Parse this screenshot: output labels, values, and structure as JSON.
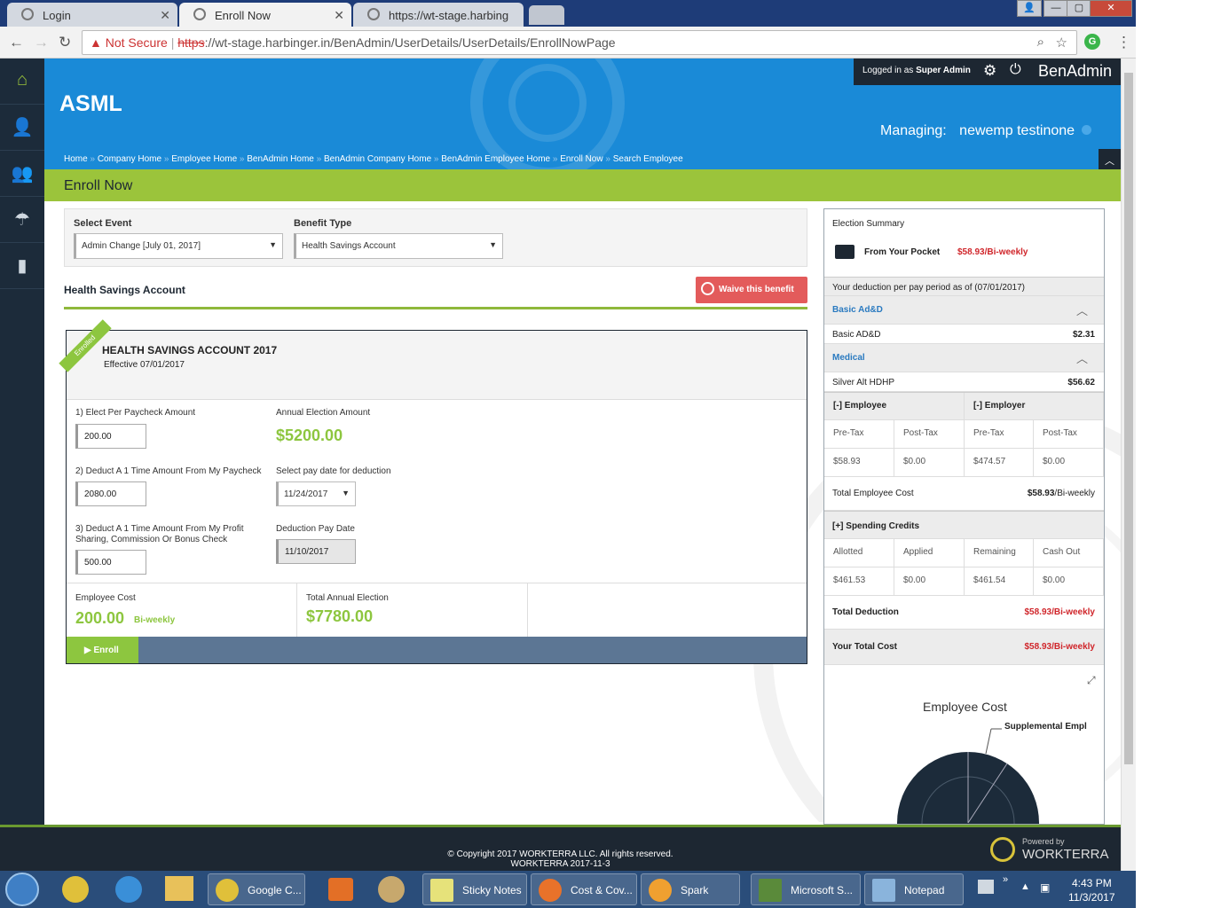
{
  "browser": {
    "tabs": [
      {
        "label": "Login"
      },
      {
        "label": "Enroll Now"
      },
      {
        "label": "https://wt-stage.harbing"
      }
    ],
    "security": "Not Secure",
    "url_scheme": "https",
    "url_rest": "://wt-stage.harbinger.in/BenAdmin/UserDetails/UserDetails/EnrollNowPage"
  },
  "header": {
    "logged_prefix": "Logged in as",
    "logged_role": "Super Admin",
    "brand": "BenAdmin",
    "company": "ASML",
    "managing_label": "Managing:",
    "managing_name": "newemp testinone",
    "breadcrumbs": [
      "Home",
      "Company Home",
      "Employee Home",
      "BenAdmin Home",
      "BenAdmin Company Home",
      "BenAdmin Employee Home",
      "Enroll Now",
      "Search Employee"
    ],
    "page_title": "Enroll Now"
  },
  "filters": {
    "event_label": "Select Event",
    "event_value": "Admin Change [July 01, 2017]",
    "benefit_label": "Benefit Type",
    "benefit_value": "Health Savings Account"
  },
  "section": {
    "title": "Health Savings Account",
    "waive_label": "Waive this benefit"
  },
  "plan": {
    "ribbon": "Enrolled",
    "name": "HEALTH SAVINGS ACCOUNT 2017",
    "effective": "Effective 07/01/2017",
    "q1_label": "1) Elect Per Paycheck Amount",
    "q1_value": "200.00",
    "annual_label": "Annual Election Amount",
    "annual_value": "$5200.00",
    "q2_label": "2) Deduct A 1 Time Amount From My Paycheck",
    "q2_value": "2080.00",
    "paydate_label": "Select pay date for deduction",
    "paydate_value": "11/24/2017",
    "q3_label_1": "3) Deduct A 1 Time Amount From My Profit",
    "q3_label_2": "Sharing, Commission Or Bonus Check",
    "q3_value": "500.00",
    "deddate_label": "Deduction Pay Date",
    "deddate_value": "11/10/2017",
    "empcost_label": "Employee Cost",
    "empcost_value": "200.00",
    "empcost_freq": "Bi-weekly",
    "total_label": "Total Annual Election",
    "total_value": "$7780.00",
    "enroll_label": "Enroll"
  },
  "summary": {
    "title": "Election Summary",
    "pocket_label": "From Your Pocket",
    "pocket_value": "$58.93/Bi-weekly",
    "deduction_note": "Your deduction per pay period as of (07/01/2017)",
    "groups": [
      {
        "name": "Basic Ad&D",
        "item": "Basic AD&D",
        "amount": "$2.31"
      },
      {
        "name": "Medical",
        "item": "Silver Alt HDHP",
        "amount": "$56.62"
      }
    ],
    "employee_head": "[-] Employee",
    "employer_head": "[-] Employer",
    "cols": [
      "Pre-Tax",
      "Post-Tax",
      "Pre-Tax",
      "Post-Tax"
    ],
    "vals": [
      "$58.93",
      "$0.00",
      "$474.57",
      "$0.00"
    ],
    "total_emp_label": "Total Employee Cost",
    "total_emp_value": "$58.93",
    "total_emp_freq": "/Bi-weekly",
    "credits_head": "[+] Spending Credits",
    "credit_cols": [
      "Allotted",
      "Applied",
      "Remaining",
      "Cash Out"
    ],
    "credit_vals": [
      "$461.53",
      "$0.00",
      "$461.54",
      "$0.00"
    ],
    "total_ded_label": "Total Deduction",
    "total_ded_value": "$58.93/Bi-weekly",
    "your_total_label": "Your Total Cost",
    "your_total_value": "$58.93/Bi-weekly",
    "chart_title": "Employee Cost",
    "chart_label": "Supplemental Empl"
  },
  "footer": {
    "copyright": "© Copyright 2017 WORKTERRA LLC. All rights reserved.",
    "build": "WORKTERRA 2017-11-3",
    "powered": "Powered by",
    "brand": "WORKTERRA"
  },
  "taskbar": {
    "items": [
      "Google C...",
      "Sticky Notes",
      "Cost & Cov...",
      "Spark",
      "Microsoft S...",
      "Notepad"
    ],
    "time": "4:43 PM",
    "date": "11/3/2017"
  },
  "colors": {
    "accent": "#1a8ad7",
    "green": "#9bc43b",
    "red": "#d0262b",
    "navy": "#1c2b3a"
  }
}
